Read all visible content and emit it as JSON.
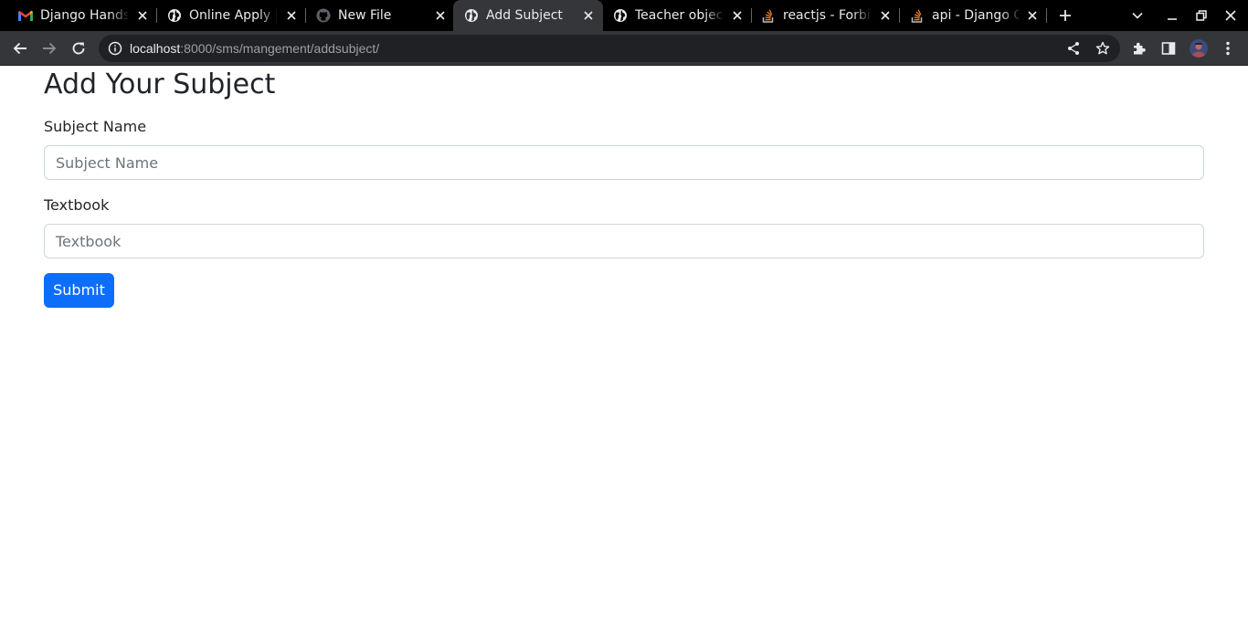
{
  "browser": {
    "tabs": [
      {
        "title": "Django Hands",
        "icon": "gmail-icon",
        "active": false
      },
      {
        "title": "Online Apply |",
        "icon": "globe-icon",
        "active": false
      },
      {
        "title": "New File",
        "icon": "github-icon",
        "active": false
      },
      {
        "title": "Add Subject",
        "icon": "globe-icon",
        "active": true
      },
      {
        "title": "Teacher object",
        "icon": "globe-icon",
        "active": false
      },
      {
        "title": "reactjs - Forbid",
        "icon": "stackoverflow-icon",
        "active": false
      },
      {
        "title": "api - Django CS",
        "icon": "stackoverflow-icon",
        "active": false
      }
    ],
    "address": {
      "host": "localhost",
      "path": ":8000/sms/mangement/addsubject/"
    },
    "colors": {
      "tabstrip": "#000000",
      "toolbar": "#35363a",
      "omnibox": "#202124"
    }
  },
  "page": {
    "title": "Add Your Subject",
    "form": {
      "subject_name": {
        "label": "Subject Name",
        "placeholder": "Subject Name",
        "value": ""
      },
      "textbook": {
        "label": "Textbook",
        "placeholder": "Textbook",
        "value": ""
      },
      "submit_label": "Submit"
    },
    "colors": {
      "primary": "#0d6efd",
      "text": "#212529",
      "border": "#ced4da"
    }
  }
}
